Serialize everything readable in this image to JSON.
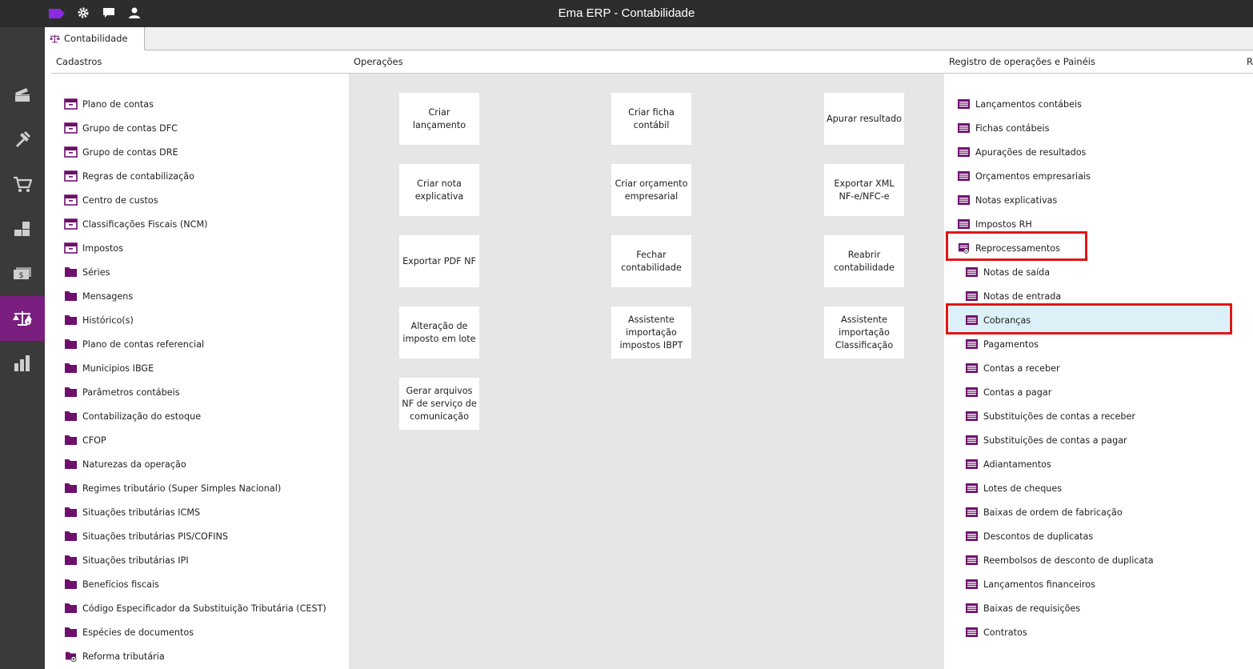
{
  "window": {
    "title": "Ema ERP - Contabilidade"
  },
  "titlebar_icons": [
    "tag-icon",
    "gear-icon",
    "chat-icon",
    "user-icon"
  ],
  "sidebar": {
    "items": [
      {
        "icon": "register-icon",
        "active": false
      },
      {
        "icon": "tools-icon",
        "active": false
      },
      {
        "icon": "cart-icon",
        "active": false
      },
      {
        "icon": "stock-icon",
        "active": false
      },
      {
        "icon": "money-icon",
        "active": false
      },
      {
        "icon": "scale-icon",
        "active": true
      },
      {
        "icon": "bar-chart-icon",
        "active": false
      }
    ]
  },
  "tab": {
    "label": "Contabilidade",
    "icon": "scale-icon"
  },
  "sections": {
    "cadastros": "Cadastros",
    "operacoes": "Operações",
    "registro": "Registro de operações e Painéis",
    "overflow": "R"
  },
  "cadastros": [
    {
      "label": "Plano de contas",
      "icon": "archive-icon"
    },
    {
      "label": "Grupo de contas DFC",
      "icon": "archive-icon"
    },
    {
      "label": "Grupo de contas DRE",
      "icon": "archive-icon"
    },
    {
      "label": "Regras de contabilização",
      "icon": "archive-icon"
    },
    {
      "label": "Centro de custos",
      "icon": "archive-icon"
    },
    {
      "label": "Classificações Fiscais (NCM)",
      "icon": "archive-icon"
    },
    {
      "label": "Impostos",
      "icon": "archive-icon"
    },
    {
      "label": "Séries",
      "icon": "folder-icon"
    },
    {
      "label": "Mensagens",
      "icon": "folder-icon"
    },
    {
      "label": "Histórico(s)",
      "icon": "folder-icon"
    },
    {
      "label": "Plano de contas referencial",
      "icon": "folder-icon"
    },
    {
      "label": "Municipios IBGE",
      "icon": "folder-icon"
    },
    {
      "label": "Parâmetros contábeis",
      "icon": "folder-icon"
    },
    {
      "label": "Contabilização do estoque",
      "icon": "folder-icon"
    },
    {
      "label": "CFOP",
      "icon": "folder-icon"
    },
    {
      "label": "Naturezas da operação",
      "icon": "folder-icon"
    },
    {
      "label": "Regimes tributário (Super Simples Nacional)",
      "icon": "folder-icon"
    },
    {
      "label": "Situações tributárias ICMS",
      "icon": "folder-icon"
    },
    {
      "label": "Situações tributárias PIS/COFINS",
      "icon": "folder-icon"
    },
    {
      "label": "Situações tributárias IPI",
      "icon": "folder-icon"
    },
    {
      "label": "Benefícios fiscais",
      "icon": "folder-icon"
    },
    {
      "label": "Código Especificador da Substituição Tributária (CEST)",
      "icon": "folder-icon"
    },
    {
      "label": "Espécies de documentos",
      "icon": "folder-icon"
    },
    {
      "label": "Reforma tributária",
      "icon": "folder-plus-icon"
    }
  ],
  "operacoes": [
    [
      "Criar lançamento",
      "Criar ficha contábil",
      "Apurar resultado"
    ],
    [
      "Criar nota explicativa",
      "Criar orçamento empresarial",
      "Exportar XML NF-e/NFC-e"
    ],
    [
      "Exportar PDF NF",
      "Fechar contabilidade",
      "Reabrir contabilidade"
    ],
    [
      "Alteração de imposto em lote",
      "Assistente importação impostos IBPT",
      "Assistente importação Classificação"
    ],
    [
      "Gerar arquivos NF de serviço de comunicação"
    ]
  ],
  "registro": [
    {
      "label": "Lançamentos contábeis",
      "indent": false
    },
    {
      "label": "Fichas contábeis",
      "indent": false
    },
    {
      "label": "Apurações de resultados",
      "indent": false
    },
    {
      "label": "Orçamentos empresariais",
      "indent": false
    },
    {
      "label": "Notas explicativas",
      "indent": false
    },
    {
      "label": "Impostos RH",
      "indent": false
    },
    {
      "label": "Reprocessamentos",
      "indent": false,
      "group": true
    },
    {
      "label": "Notas de saída",
      "indent": true
    },
    {
      "label": "Notas de entrada",
      "indent": true
    },
    {
      "label": "Cobranças",
      "indent": true,
      "selected": true
    },
    {
      "label": "Pagamentos",
      "indent": true
    },
    {
      "label": "Contas a receber",
      "indent": true
    },
    {
      "label": "Contas a pagar",
      "indent": true
    },
    {
      "label": "Substituições de contas a receber",
      "indent": true
    },
    {
      "label": "Substituições de contas a pagar",
      "indent": true
    },
    {
      "label": "Adiantamentos",
      "indent": true
    },
    {
      "label": "Lotes de cheques",
      "indent": true
    },
    {
      "label": "Baixas de ordem de fabricação",
      "indent": true
    },
    {
      "label": "Descontos de duplicatas",
      "indent": true
    },
    {
      "label": "Reembolsos de desconto de duplicata",
      "indent": true
    },
    {
      "label": "Lançamentos financeiros",
      "indent": true
    },
    {
      "label": "Baixas de requisições",
      "indent": true
    },
    {
      "label": "Contratos",
      "indent": true
    }
  ],
  "colors": {
    "accent": "#7a1f7f",
    "icon_purple": "#6e0f6e",
    "highlight_red": "#e01515",
    "selected_bg": "#dcf0f8"
  }
}
